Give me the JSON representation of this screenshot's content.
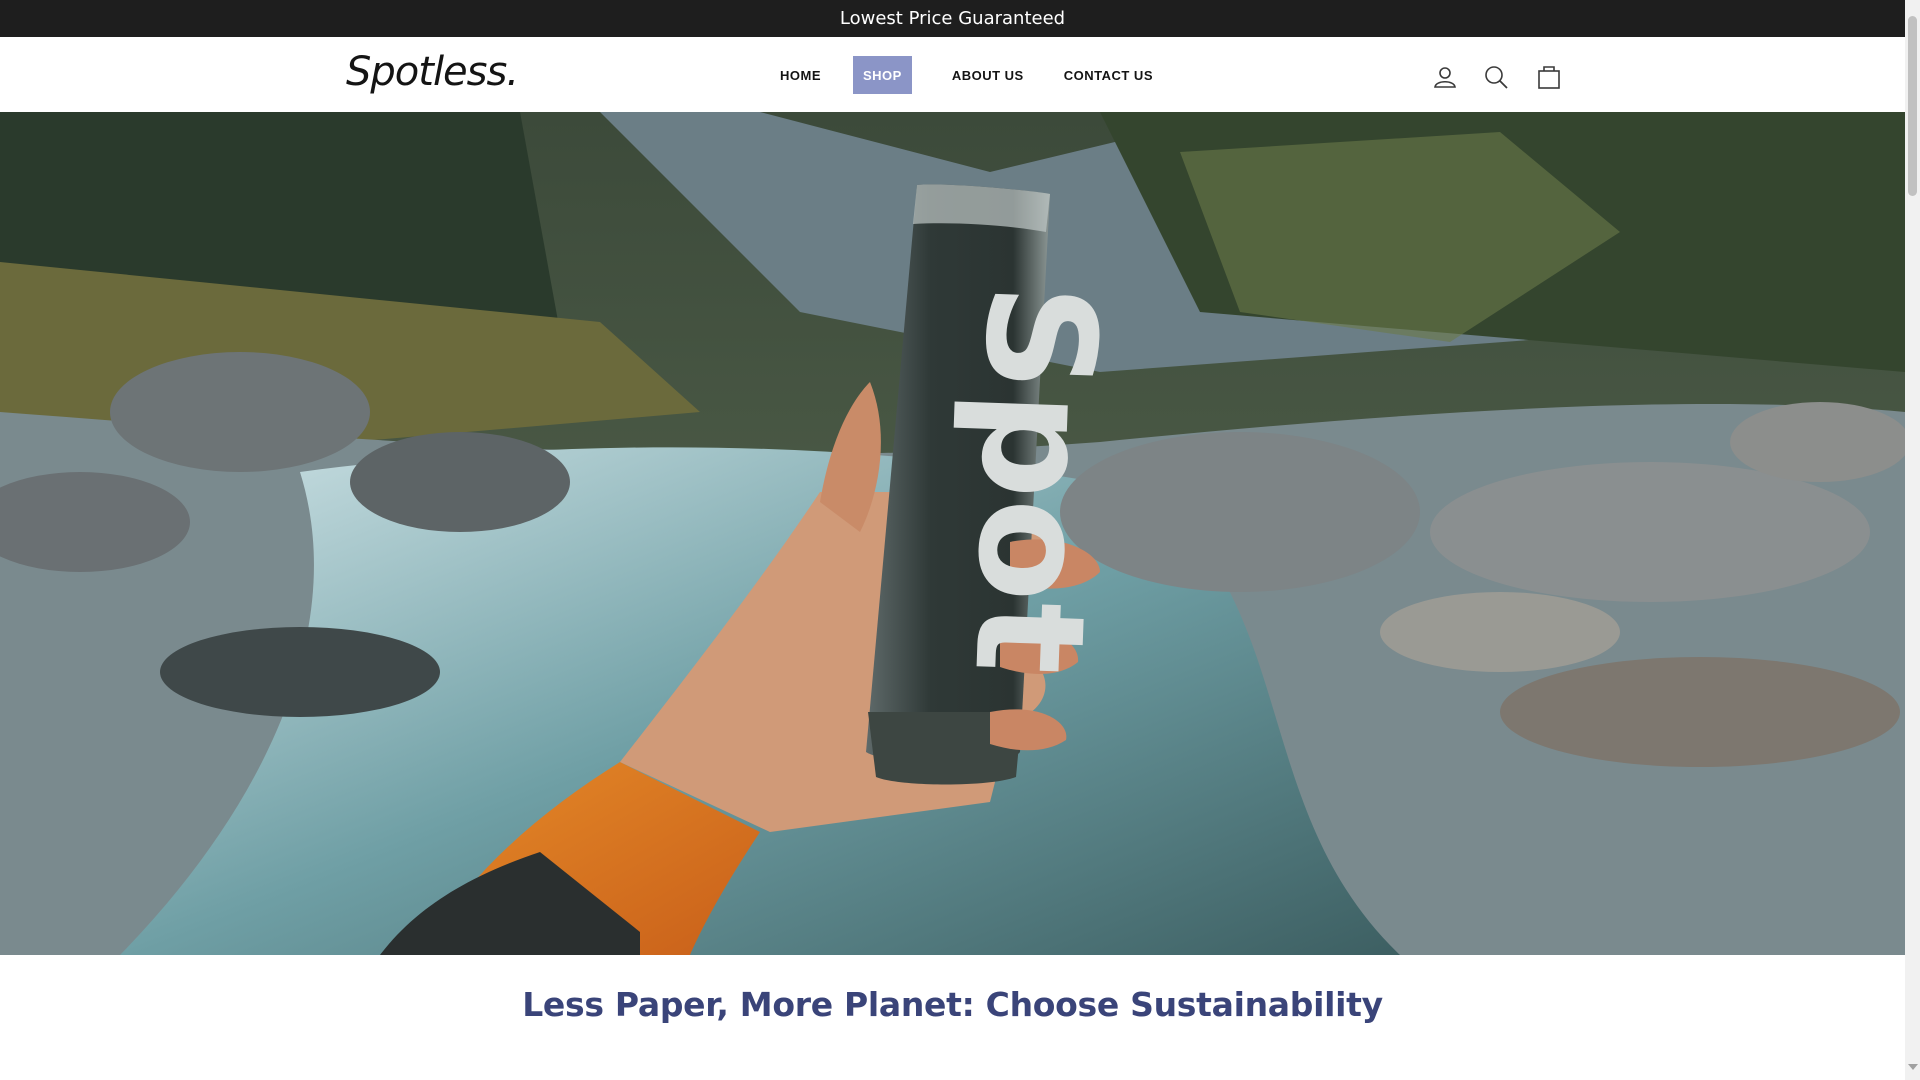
{
  "announcement": {
    "text": "Lowest Price Guaranteed"
  },
  "header": {
    "logo": "Spotless.",
    "nav": [
      {
        "label": "HOME",
        "active": false
      },
      {
        "label": "SHOP",
        "active": true
      },
      {
        "label": "ABOUT US",
        "active": false
      },
      {
        "label": "CONTACT US",
        "active": false
      }
    ],
    "icons": [
      "user-icon",
      "search-icon",
      "cart-icon"
    ]
  },
  "hero": {
    "bottle_text": "Spot"
  },
  "headline": "Less Paper, More Planet: Choose Sustainability",
  "colors": {
    "announcement_bg": "#1e1e1e",
    "nav_active_bg": "#8b95c7",
    "headline": "#3a4479"
  }
}
